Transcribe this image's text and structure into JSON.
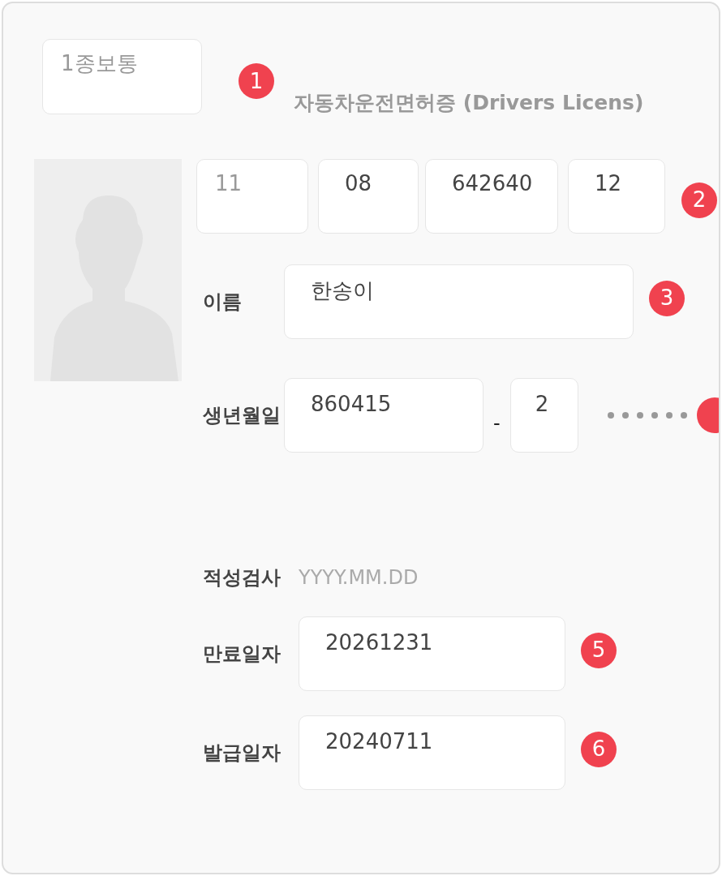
{
  "license_type": {
    "placeholder": "1종보통"
  },
  "title": "자동차운전면허증 (Drivers Licens)",
  "markers": [
    "1",
    "2",
    "3",
    "5",
    "6"
  ],
  "license_number": [
    {
      "placeholder": "11"
    },
    {
      "value": "08"
    },
    {
      "value": "642640"
    },
    {
      "value": "12"
    }
  ],
  "name": {
    "label": "이름",
    "value": "한송이"
  },
  "birth": {
    "label": "생년월일",
    "front": "860415",
    "separator": "-",
    "back_first": "2"
  },
  "aptitude_test": {
    "label": "적성검사",
    "placeholder": "YYYY.MM.DD"
  },
  "expiry": {
    "label": "만료일자",
    "value": "20261231"
  },
  "issue": {
    "label": "발급일자",
    "value": "20240711"
  }
}
